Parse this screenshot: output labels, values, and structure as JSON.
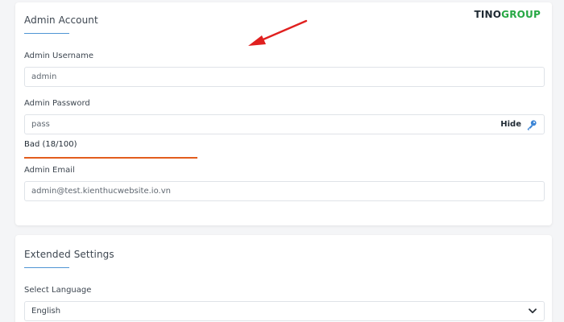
{
  "logo": {
    "part1": "TINO",
    "part2": "GROUP"
  },
  "admin_account": {
    "title": "Admin Account",
    "username": {
      "label": "Admin Username",
      "value": "admin"
    },
    "password": {
      "label": "Admin Password",
      "value": "pass",
      "toggle_label": "Hide",
      "strength_text": "Bad (18/100)",
      "strength_score": 18
    },
    "email": {
      "label": "Admin Email",
      "value": "admin@test.kienthucwebsite.io.vn"
    }
  },
  "extended_settings": {
    "title": "Extended Settings",
    "language": {
      "label": "Select Language",
      "selected": "English"
    }
  },
  "colors": {
    "accent_blue": "#4f95d4",
    "strength_bad": "#e25d1d",
    "annotation_arrow": "#e0201f",
    "logo_dark": "#1f2a33",
    "logo_green": "#27a844"
  },
  "icons": {
    "password_toggle": "key-icon",
    "select_toggle": "chevron-down-icon",
    "annotation": "red-arrow-icon"
  }
}
